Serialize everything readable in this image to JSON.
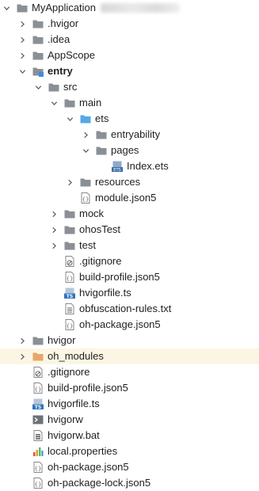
{
  "tree": {
    "project_name": "MyApplication",
    "items": [
      {
        "label": "MyApplication",
        "icon": "folder-icon",
        "expanded": true
      },
      {
        "label": ".hvigor",
        "icon": "folder-icon",
        "expanded": false
      },
      {
        "label": ".idea",
        "icon": "folder-icon",
        "expanded": false
      },
      {
        "label": "AppScope",
        "icon": "folder-icon",
        "expanded": false
      },
      {
        "label": "entry",
        "icon": "module-folder-icon",
        "expanded": true
      },
      {
        "label": "src",
        "icon": "folder-icon",
        "expanded": true
      },
      {
        "label": "main",
        "icon": "folder-icon",
        "expanded": true
      },
      {
        "label": "ets",
        "icon": "source-folder-icon",
        "expanded": true
      },
      {
        "label": "entryability",
        "icon": "folder-icon",
        "expanded": false
      },
      {
        "label": "pages",
        "icon": "folder-icon",
        "expanded": true
      },
      {
        "label": "Index.ets",
        "icon": "ets-file-icon"
      },
      {
        "label": "resources",
        "icon": "folder-icon",
        "expanded": false
      },
      {
        "label": "module.json5",
        "icon": "json5-file-icon"
      },
      {
        "label": "mock",
        "icon": "folder-icon",
        "expanded": false
      },
      {
        "label": "ohosTest",
        "icon": "folder-icon",
        "expanded": false
      },
      {
        "label": "test",
        "icon": "folder-icon",
        "expanded": false
      },
      {
        "label": ".gitignore",
        "icon": "gitignore-file-icon"
      },
      {
        "label": "build-profile.json5",
        "icon": "json5-file-icon"
      },
      {
        "label": "hvigorfile.ts",
        "icon": "ts-file-icon"
      },
      {
        "label": "obfuscation-rules.txt",
        "icon": "text-file-icon"
      },
      {
        "label": "oh-package.json5",
        "icon": "json5-file-icon"
      },
      {
        "label": "hvigor",
        "icon": "folder-icon",
        "expanded": false
      },
      {
        "label": "oh_modules",
        "icon": "excluded-folder-icon",
        "expanded": false
      },
      {
        "label": ".gitignore",
        "icon": "gitignore-file-icon"
      },
      {
        "label": "build-profile.json5",
        "icon": "json5-file-icon"
      },
      {
        "label": "hvigorfile.ts",
        "icon": "ts-file-icon"
      },
      {
        "label": "hvigorw",
        "icon": "script-file-icon"
      },
      {
        "label": "hvigorw.bat",
        "icon": "bat-file-icon"
      },
      {
        "label": "local.properties",
        "icon": "properties-file-icon"
      },
      {
        "label": "oh-package.json5",
        "icon": "json5-file-icon"
      },
      {
        "label": "oh-package-lock.json5",
        "icon": "json5-file-icon"
      }
    ]
  },
  "colors": {
    "folder": "#8b9096",
    "source_folder": "#56a8e6",
    "excluded_folder": "#e9a56a",
    "ts_badge": "#2f74c0",
    "highlight_row": "#fbf6e3"
  }
}
